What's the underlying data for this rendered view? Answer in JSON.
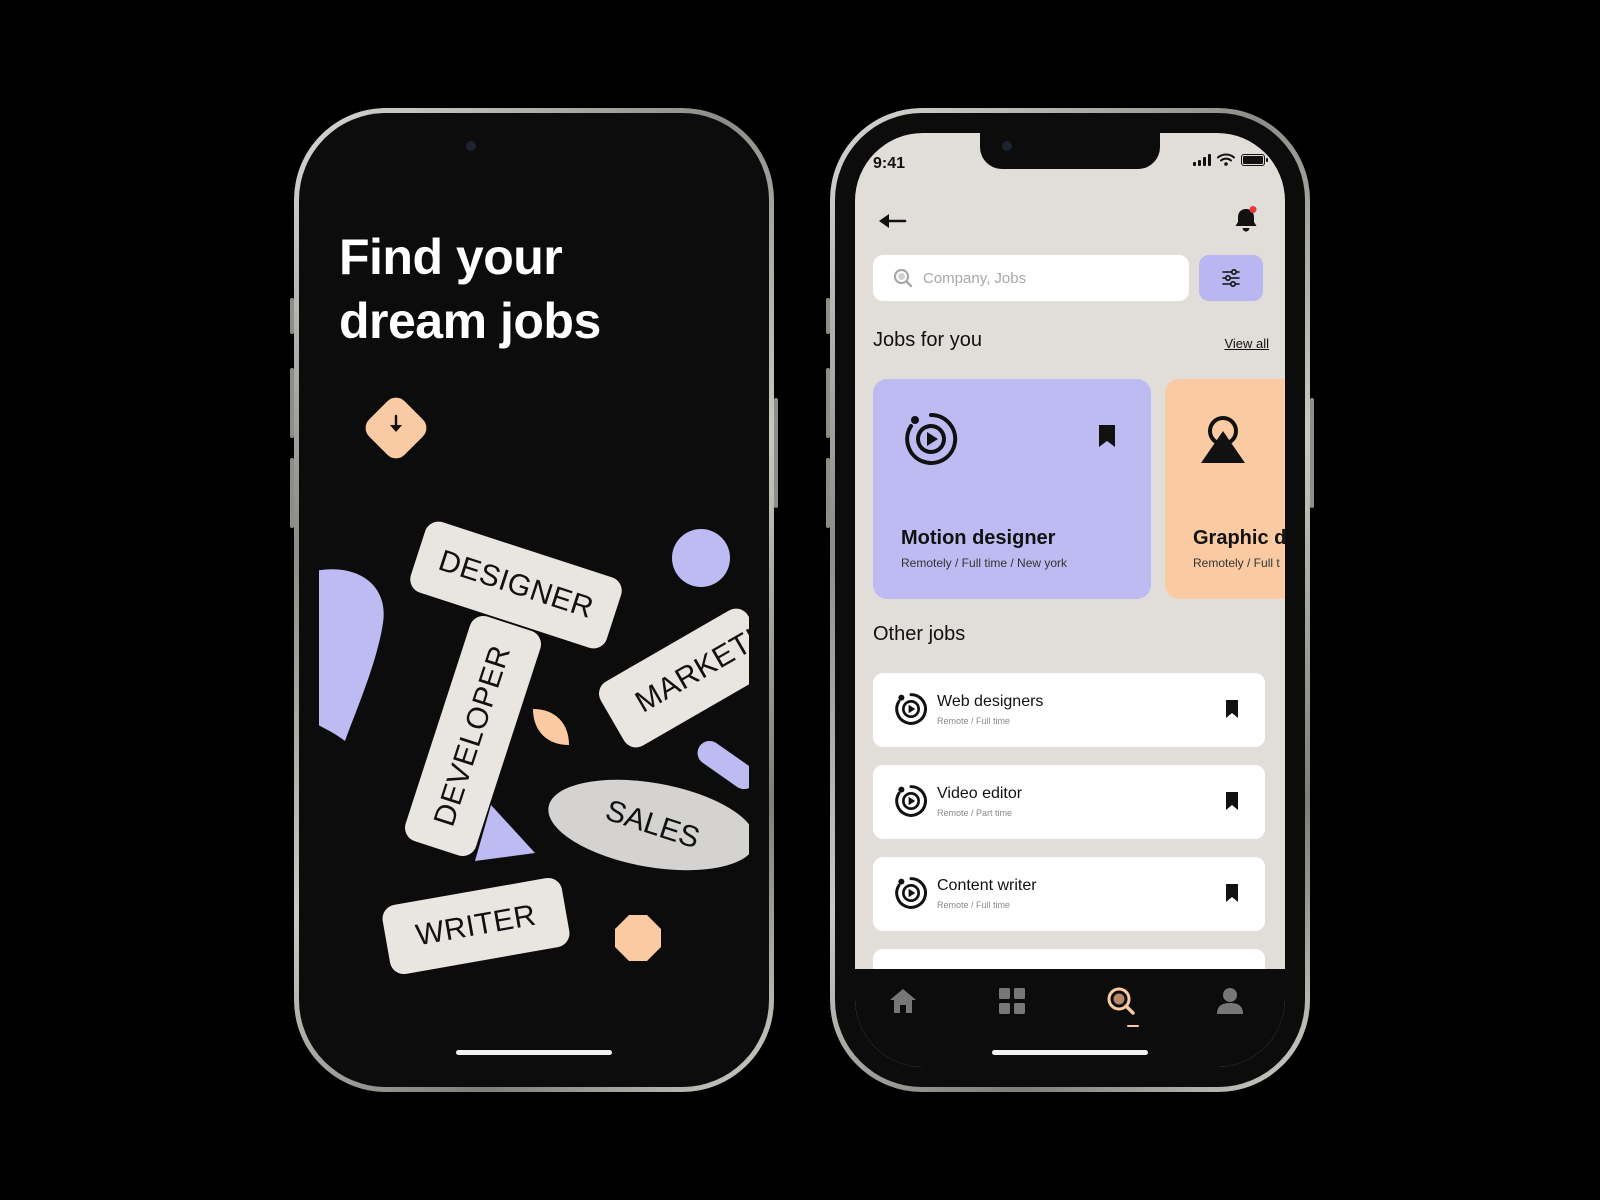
{
  "welcome": {
    "title_line1": "Find your",
    "title_line2": "dream jobs",
    "tags": [
      "DESIGNER",
      "DEVELOPER",
      "MARKETI",
      "SALES",
      "WRITER"
    ]
  },
  "status_bar": {
    "time": "9:41"
  },
  "search": {
    "placeholder": "Company, Jobs",
    "value": ""
  },
  "jobs_for_you": {
    "title": "Jobs for you",
    "view_all": "View all",
    "cards": [
      {
        "title": "Motion designer",
        "meta": "Remotely / Full time / New york",
        "color": "#bebbf3"
      },
      {
        "title": "Graphic d",
        "meta": "Remotely / Full t",
        "color": "#facba3"
      }
    ]
  },
  "other_jobs": {
    "title": "Other jobs",
    "items": [
      {
        "title": "Web designers",
        "meta": "Remote / Full time"
      },
      {
        "title": "Video editor",
        "meta": "Remote / Part time"
      },
      {
        "title": "Content writer",
        "meta": "Remote / Full time"
      }
    ]
  },
  "nav": {
    "active": "search"
  },
  "colors": {
    "accent_purple": "#bebbf3",
    "accent_peach": "#facba3",
    "background_light": "#e1ddd9",
    "background_dark": "#0c0c0c",
    "notification": "#e53935"
  },
  "icons": [
    "arrow-down-icon",
    "back-arrow-icon",
    "bell-icon",
    "search-icon",
    "filter-icon",
    "motion-play-icon",
    "mountain-icon",
    "bookmark-icon",
    "home-icon",
    "grid-icon",
    "user-icon"
  ]
}
